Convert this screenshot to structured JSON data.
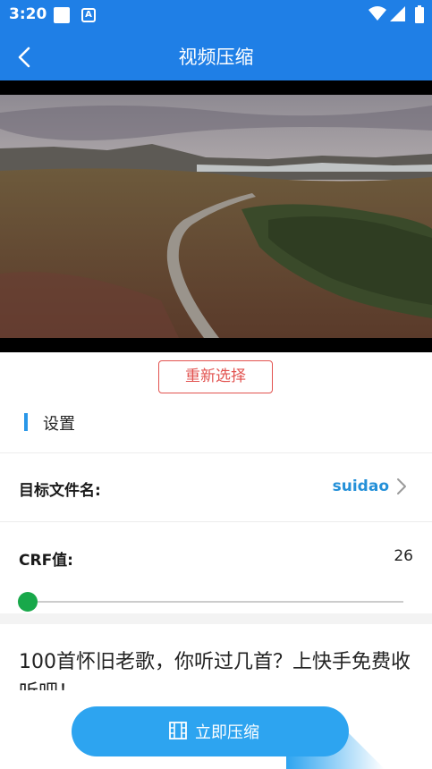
{
  "status_bar": {
    "time": "3:20",
    "icons": [
      "notification-square-icon",
      "a-badge-icon",
      "wifi-icon",
      "signal-icon",
      "battery-icon"
    ]
  },
  "app_bar": {
    "title": "视频压缩",
    "back_icon": "back-arrow-icon",
    "background": "#1f7fe6"
  },
  "video": {
    "description_icon": "video-preview-thumbnail"
  },
  "reselect_button": {
    "label": "重新选择",
    "color": "#e2524f"
  },
  "settings": {
    "section_title": "设置",
    "accent": "#2997e8",
    "target_filename": {
      "label": "目标文件名:",
      "value": "suidao",
      "value_color": "#2490d8"
    },
    "crf": {
      "label": "CRF值:",
      "value": "26",
      "slider_position_fraction": 0.0,
      "thumb_color": "#18a84a"
    }
  },
  "ad": {
    "text": "100首怀旧老歌，你听过几首？上快手免费收听吧！"
  },
  "compress_button": {
    "label": "立即压缩",
    "icon": "film-icon",
    "color": "#2da4f0"
  }
}
